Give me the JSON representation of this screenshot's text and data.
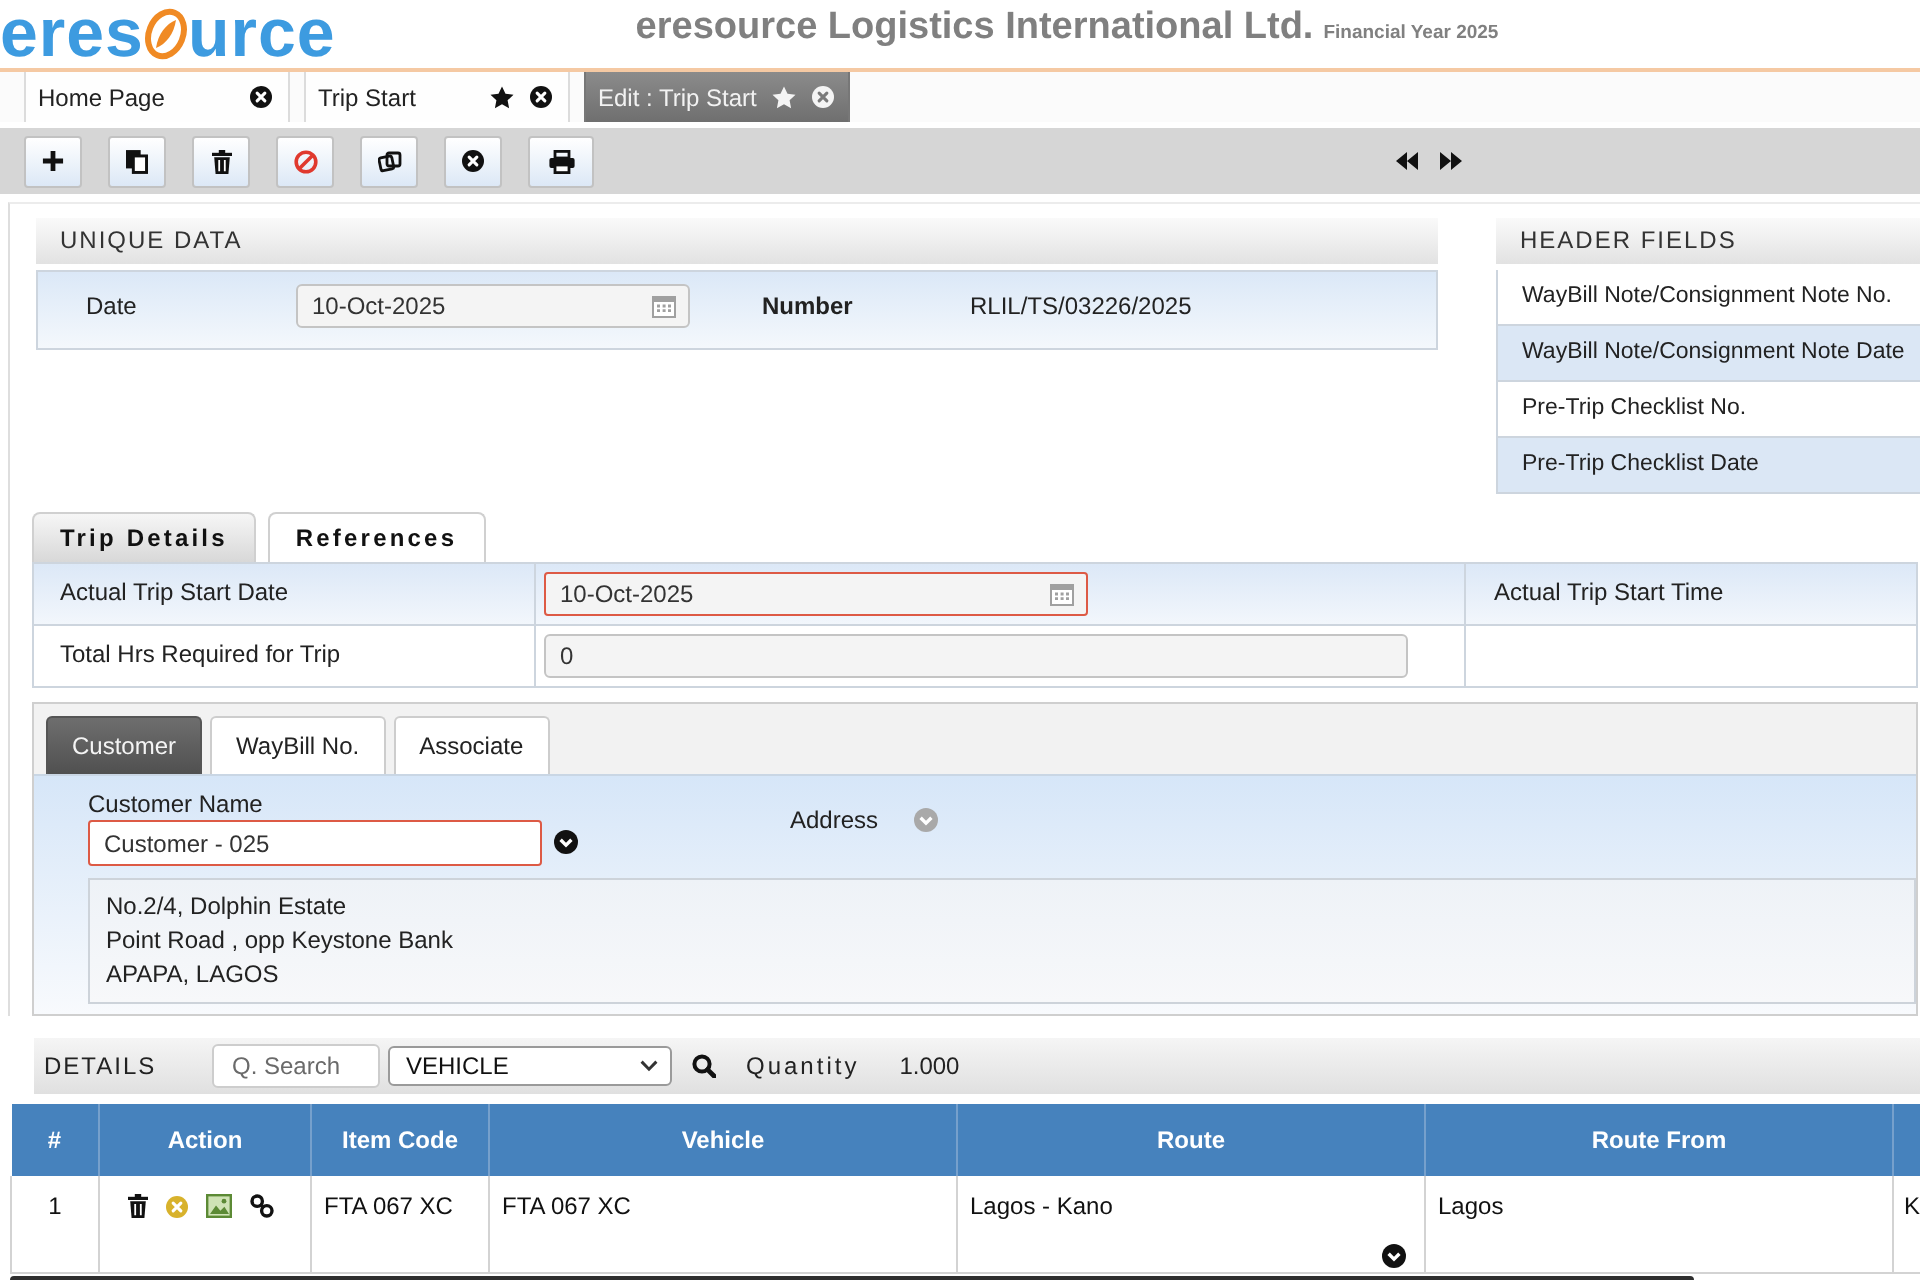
{
  "header": {
    "logo": {
      "text_start": "eres",
      "text_end": "urce"
    },
    "company": "eresource Logistics International Ltd.",
    "financial_year": "Financial Year 2025"
  },
  "tabs": [
    {
      "label": "Home Page",
      "selected": false,
      "starred": false
    },
    {
      "label": "Trip Start",
      "selected": false,
      "starred": true
    },
    {
      "label": "Edit : Trip Start",
      "selected": true,
      "starred": true
    }
  ],
  "unique_data": {
    "title": "UNIQUE DATA",
    "fields": [
      {
        "kind": "date",
        "label": "Date",
        "value": "10-Oct-2025"
      },
      {
        "kind": "readonly",
        "label": "Number",
        "value": "RLIL/TS/03226/2025"
      }
    ]
  },
  "header_fields": {
    "title": "HEADER FIELDS",
    "items": [
      "WayBill Note/Consignment Note No.",
      "WayBill Note/Consignment Note Date",
      "Pre-Trip Checklist No.",
      "Pre-Trip Checklist Date"
    ]
  },
  "section_tabs": [
    {
      "label": "Trip Details",
      "selected": true
    },
    {
      "label": "References",
      "selected": false
    }
  ],
  "trip_details": {
    "fields": [
      {
        "kind": "date",
        "label": "Actual Trip Start Date",
        "value": "10-Oct-2025",
        "required": true
      },
      {
        "kind": "text",
        "label": "Total Hrs Required for Trip",
        "value": "0",
        "required": false
      }
    ],
    "side_label": "Actual Trip Start Time"
  },
  "customer_panel": {
    "tabs": [
      {
        "label": "Customer",
        "selected": true
      },
      {
        "label": "WayBill No.",
        "selected": false
      },
      {
        "label": "Associate",
        "selected": false
      }
    ],
    "customer_name": {
      "label": "Customer Name",
      "value": "Customer - 025",
      "required": true
    },
    "address": {
      "label": "Address",
      "lines": [
        "No.2/4, Dolphin Estate",
        "Point Road , opp Keystone Bank",
        "APAPA, LAGOS"
      ]
    }
  },
  "details": {
    "title": "DETAILS",
    "search": {
      "placeholder": "Q. Search"
    },
    "item_type": {
      "value": "VEHICLE"
    },
    "quantity": {
      "label": "Quantity",
      "value": "1.000"
    },
    "table": {
      "columns": [
        "#",
        "Action",
        "Item Code",
        "Vehicle",
        "Route",
        "Route From"
      ],
      "rows": [
        {
          "number": "1",
          "item_code": "FTA 067 XC",
          "vehicle": "FTA 067 XC",
          "route": "Lagos - Kano",
          "route_from": "Lagos",
          "column_7": "K"
        }
      ]
    }
  }
}
